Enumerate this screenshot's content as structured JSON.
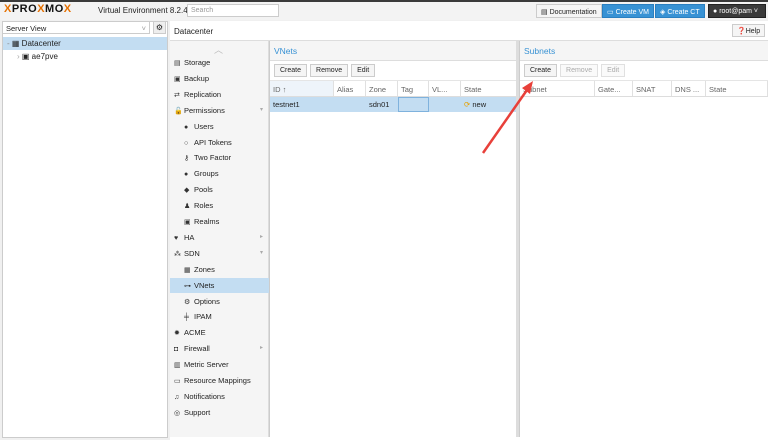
{
  "header": {
    "logo": "PROXMOX",
    "version": "Virtual Environment 8.2.4",
    "search_placeholder": "Search",
    "documentation": "Documentation",
    "create_vm": "Create VM",
    "create_ct": "Create CT",
    "user": "root@pam"
  },
  "tree": {
    "view": "Server View",
    "items": [
      {
        "label": "Datacenter",
        "selected": true
      },
      {
        "label": "ae7pve"
      }
    ]
  },
  "content": {
    "title": "Datacenter",
    "help": "Help"
  },
  "nav": [
    {
      "label": "Storage",
      "icon": "database"
    },
    {
      "label": "Backup",
      "icon": "floppy"
    },
    {
      "label": "Replication",
      "icon": "retweet"
    },
    {
      "label": "Permissions",
      "icon": "unlock",
      "expandable": true
    },
    {
      "label": "Users",
      "icon": "user",
      "sub": true
    },
    {
      "label": "API Tokens",
      "icon": "user-o",
      "sub": true
    },
    {
      "label": "Two Factor",
      "icon": "key",
      "sub": true
    },
    {
      "label": "Groups",
      "icon": "users",
      "sub": true
    },
    {
      "label": "Pools",
      "icon": "tags",
      "sub": true
    },
    {
      "label": "Roles",
      "icon": "male",
      "sub": true
    },
    {
      "label": "Realms",
      "icon": "address-book",
      "sub": true
    },
    {
      "label": "HA",
      "icon": "heartbeat",
      "expandable": true
    },
    {
      "label": "SDN",
      "icon": "sdn",
      "expandable": true
    },
    {
      "label": "Zones",
      "icon": "th",
      "sub": true
    },
    {
      "label": "VNets",
      "icon": "network",
      "sub": true,
      "selected": true
    },
    {
      "label": "Options",
      "icon": "gear",
      "sub": true
    },
    {
      "label": "IPAM",
      "icon": "map-signs",
      "sub": true
    },
    {
      "label": "ACME",
      "icon": "certificate"
    },
    {
      "label": "Firewall",
      "icon": "shield",
      "expandable": true
    },
    {
      "label": "Metric Server",
      "icon": "bar-chart"
    },
    {
      "label": "Resource Mappings",
      "icon": "folder"
    },
    {
      "label": "Notifications",
      "icon": "bell"
    },
    {
      "label": "Support",
      "icon": "comments"
    }
  ],
  "vnets": {
    "title": "VNets",
    "buttons": [
      "Create",
      "Remove",
      "Edit"
    ],
    "columns": [
      "ID ↑",
      "Alias",
      "Zone",
      "Tag",
      "VL...",
      "State"
    ],
    "rows": [
      {
        "id": "testnet1",
        "alias": "",
        "zone": "sdn01",
        "tag": "",
        "vlan": "",
        "state": "new"
      }
    ]
  },
  "subnets": {
    "title": "Subnets",
    "buttons": [
      "Create",
      "Remove",
      "Edit"
    ],
    "columns": [
      "Subnet",
      "Gate...",
      "SNAT",
      "DNS ...",
      "State"
    ]
  },
  "colors": {
    "accent": "#3892d4",
    "selection": "#c3ddf2",
    "arrow": "#e8403a",
    "brand": "#e57000"
  }
}
